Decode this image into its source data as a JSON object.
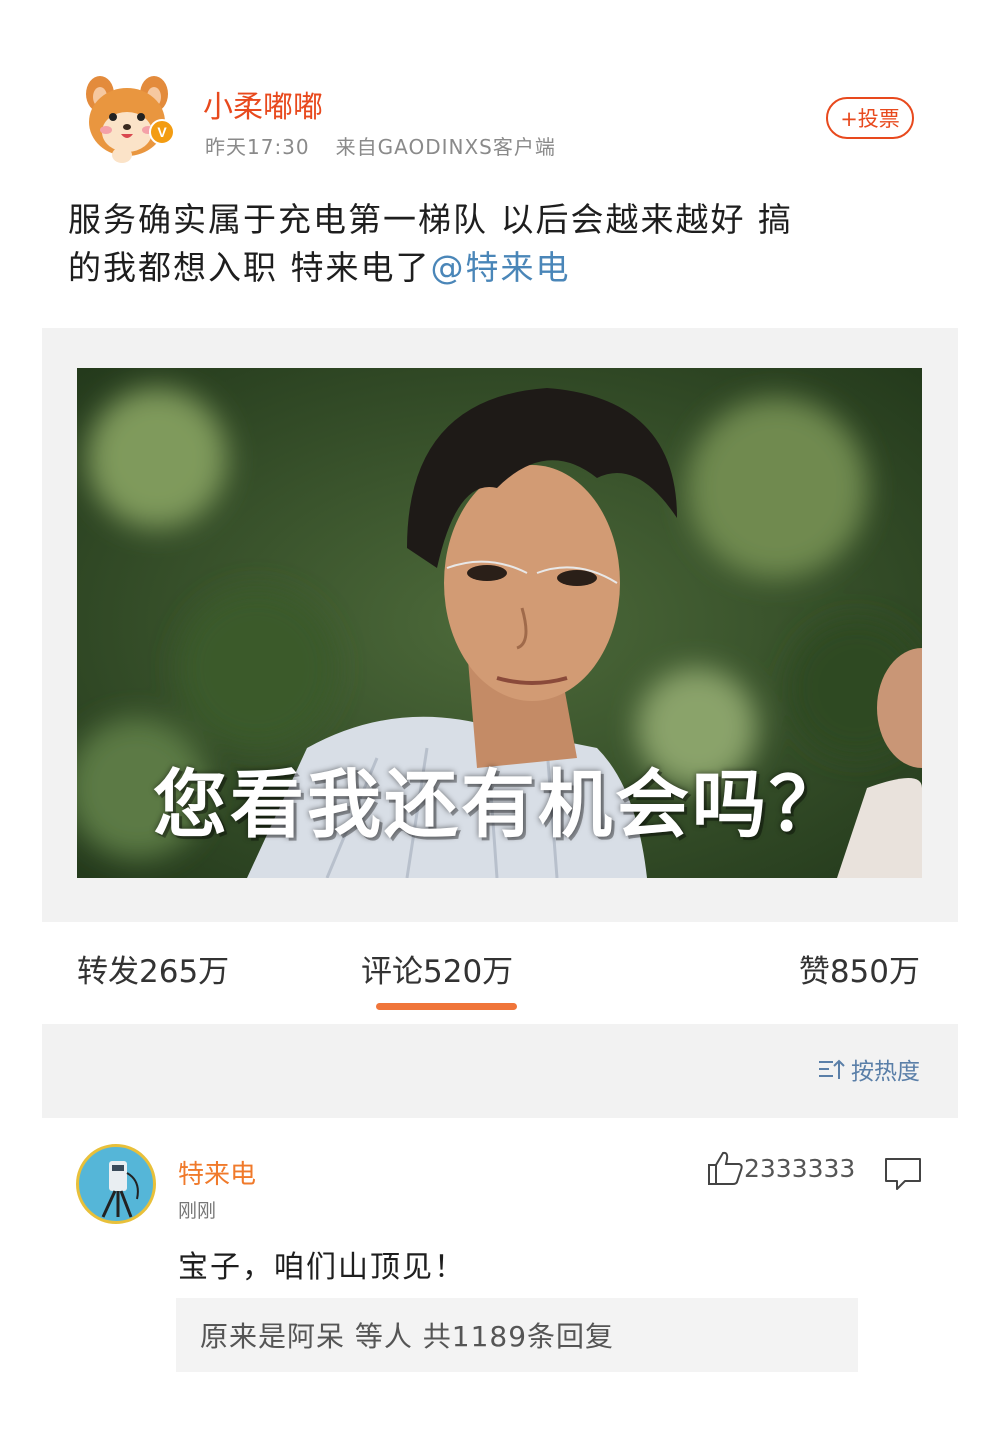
{
  "post": {
    "username": "小柔嘟嘟",
    "time": "昨天17:30",
    "source": "来自GAODINXS客户端",
    "vote_label": "+投票",
    "text_line1": "服务确实属于充电第一梯队 以后会越来越好 搞",
    "text_line2": "的我都想入职 特来电了",
    "mention": "@特来电",
    "image_caption": "您看我还有机会吗？"
  },
  "actions": {
    "repost": "转发265万",
    "comment": "评论520万",
    "like": "赞850万"
  },
  "sort": {
    "label": "按热度"
  },
  "comment": {
    "author": "特来电",
    "time": "刚刚",
    "likes": "2333333",
    "text": "宝子，咱们山顶见！",
    "replies_summary": "原来是阿呆 等人 共1189条回复"
  },
  "colors": {
    "brand_orange": "#e8491d",
    "tab_underline": "#f0753a",
    "link_blue": "#4a86b8",
    "comment_author": "#f07a2b"
  }
}
